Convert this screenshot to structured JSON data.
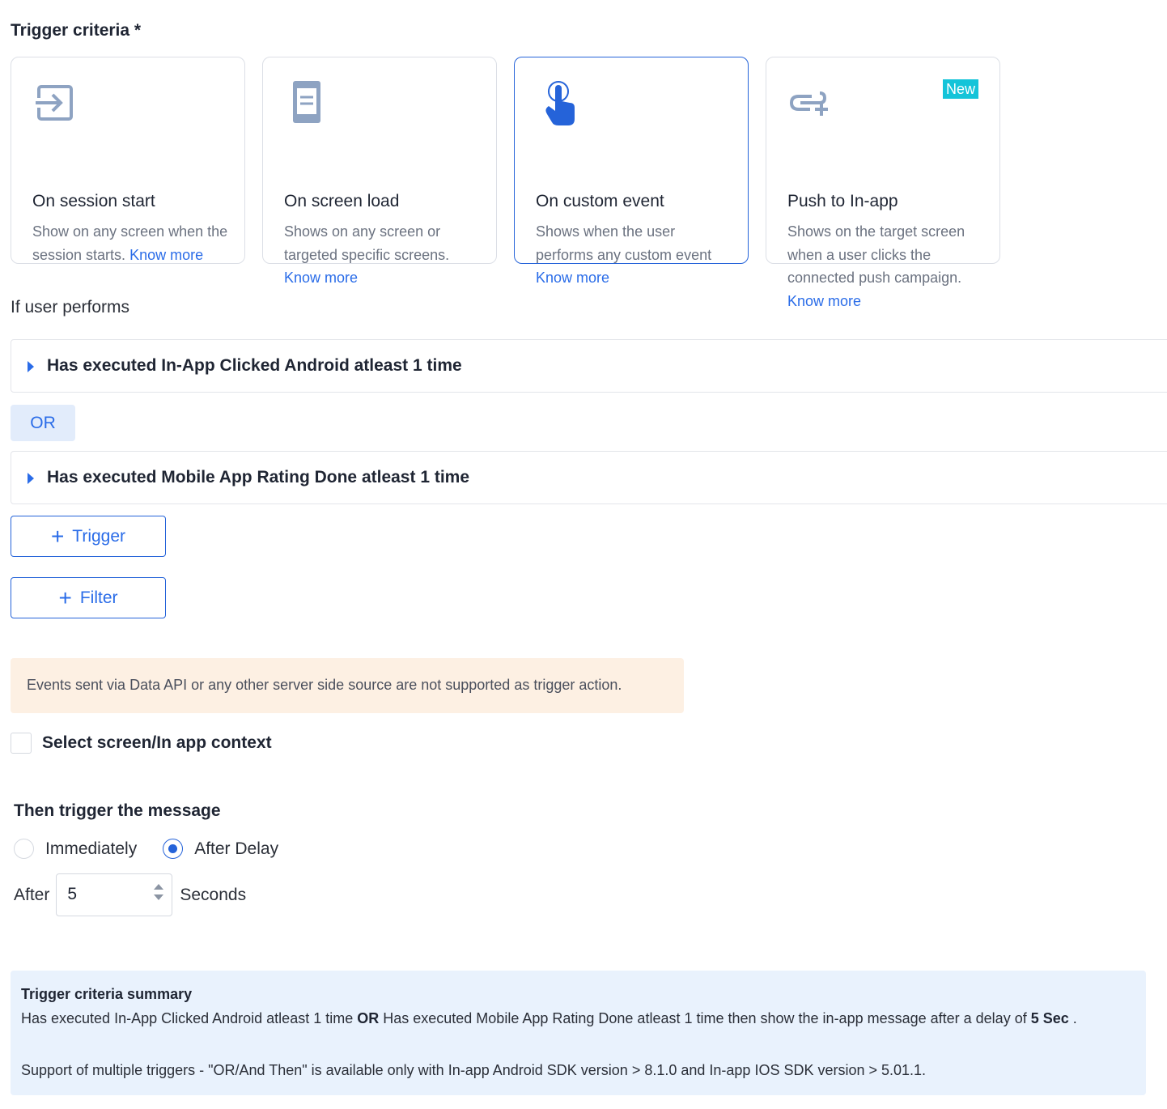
{
  "header": {
    "title": "Trigger criteria *"
  },
  "cards": [
    {
      "title": "On session start",
      "desc": "Show on any screen when the session starts.",
      "link": "Know more",
      "icon": "session-start-icon"
    },
    {
      "title": "On screen load",
      "desc": "Shows on any screen or targeted specific screens.",
      "link": "Know more",
      "icon": "screen-load-icon"
    },
    {
      "title": "On custom event",
      "desc": "Shows when the user performs any custom event",
      "link": "Know more",
      "icon": "tap-hand-icon",
      "selected": true
    },
    {
      "title": "Push to In-app",
      "desc": "Shows on the target screen when a user clicks the connected push campaign.",
      "link": "Know more",
      "icon": "push-link-icon",
      "badge": "New"
    }
  ],
  "conditions": {
    "label": "If user performs",
    "rows": [
      "Has executed In-App Clicked Android atleast 1 time",
      "Has executed Mobile App Rating Done atleast 1 time"
    ],
    "operator": "OR"
  },
  "buttons": {
    "trigger": "Trigger",
    "filter": "Filter",
    "plus": "+"
  },
  "notice": "Events sent via Data API or any other server side source are not supported as trigger action.",
  "context": {
    "label": "Select screen/In app context",
    "checked": false
  },
  "schedule": {
    "title": "Then trigger the message",
    "options": [
      "Immediately",
      "After Delay"
    ],
    "selected": "After Delay",
    "after_label": "After",
    "delay_value": "5",
    "unit_label": "Seconds"
  },
  "summary": {
    "title": "Trigger criteria summary",
    "part1": "Has executed In-App Clicked Android atleast 1 time ",
    "op": "OR",
    "part2": " Has executed Mobile App Rating Done atleast 1 time then show the in-app message after a delay of ",
    "delay": "5 Sec",
    "end": " .",
    "support": "Support of multiple triggers - \"OR/And Then\" is available only with In-app Android SDK version > 8.1.0 and In-app IOS SDK version > 5.01.1."
  },
  "colors": {
    "accent": "#2563d9",
    "link": "#2a6ce8",
    "badge": "#14c4d9",
    "notice_bg": "#fdf0e3",
    "summary_bg": "#e9f2fd",
    "or_bg": "#e2ecfb"
  }
}
